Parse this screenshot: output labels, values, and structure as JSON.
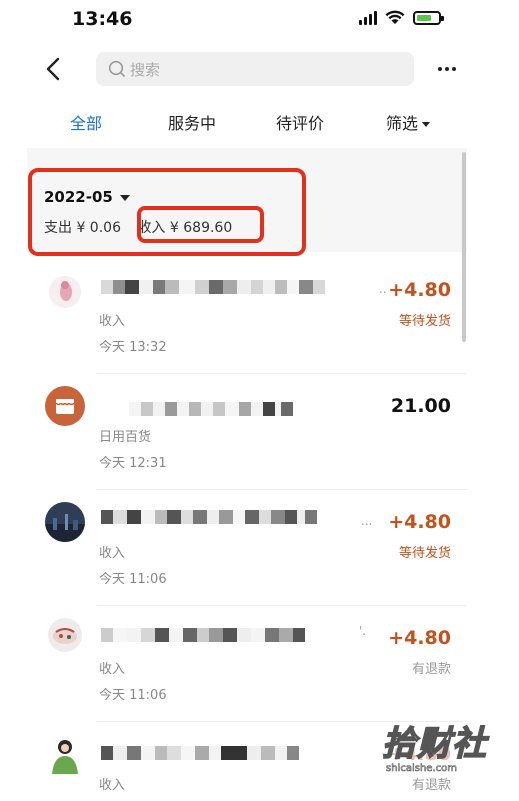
{
  "status_bar": {
    "time": "13:46"
  },
  "search": {
    "placeholder": "搜索"
  },
  "tabs": [
    {
      "label": "全部",
      "active": true
    },
    {
      "label": "服务中",
      "active": false
    },
    {
      "label": "待评价",
      "active": false
    },
    {
      "label": "筛选",
      "active": false
    }
  ],
  "month": {
    "label": "2022-05",
    "expense_label": "支出",
    "expense_value": "¥ 0.06",
    "income_label": "收入",
    "income_value": "¥ 689.60"
  },
  "transactions": [
    {
      "category": "收入",
      "time": "今天 13:32",
      "amount": "+4.80",
      "status": "等待发货",
      "avatar": "pink-figure-avatar"
    },
    {
      "category": "日用百货",
      "time": "今天 12:31",
      "amount": "21.00",
      "status": "",
      "avatar": "store-icon"
    },
    {
      "category": "收入",
      "time": "今天 11:06",
      "amount": "+4.80",
      "status": "等待发货",
      "avatar": "night-photo-avatar"
    },
    {
      "category": "收入",
      "time": "今天 11:06",
      "amount": "+4.80",
      "status": "有退款",
      "avatar": "cartoon-avatar"
    },
    {
      "category": "收入",
      "time": "",
      "amount": "+4.80",
      "status": "有退款",
      "avatar": "figure-avatar"
    }
  ],
  "watermark": {
    "cn": "拾财社",
    "en": "shicaishe.com"
  },
  "colors": {
    "accent": "#1e6fe6",
    "income": "#c4521d",
    "highlight": "#e2301d"
  }
}
